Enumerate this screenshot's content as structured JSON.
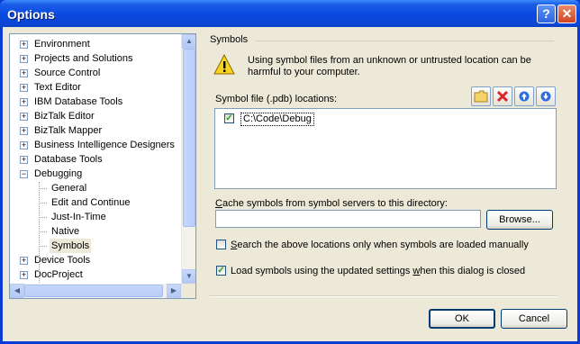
{
  "window": {
    "title": "Options"
  },
  "title_buttons": {
    "help_glyph": "?",
    "close_glyph": "✕"
  },
  "tree": {
    "items": [
      {
        "label": "Environment",
        "expander": "+",
        "indent": 0
      },
      {
        "label": "Projects and Solutions",
        "expander": "+",
        "indent": 0
      },
      {
        "label": "Source Control",
        "expander": "+",
        "indent": 0
      },
      {
        "label": "Text Editor",
        "expander": "+",
        "indent": 0
      },
      {
        "label": "IBM Database Tools",
        "expander": "+",
        "indent": 0
      },
      {
        "label": "BizTalk Editor",
        "expander": "+",
        "indent": 0
      },
      {
        "label": "BizTalk Mapper",
        "expander": "+",
        "indent": 0
      },
      {
        "label": "Business Intelligence Designers",
        "expander": "+",
        "indent": 0
      },
      {
        "label": "Database Tools",
        "expander": "+",
        "indent": 0
      },
      {
        "label": "Debugging",
        "expander": "−",
        "indent": 0
      },
      {
        "label": "General",
        "expander": "",
        "indent": 1
      },
      {
        "label": "Edit and Continue",
        "expander": "",
        "indent": 1
      },
      {
        "label": "Just-In-Time",
        "expander": "",
        "indent": 1
      },
      {
        "label": "Native",
        "expander": "",
        "indent": 1
      },
      {
        "label": "Symbols",
        "expander": "",
        "indent": 1,
        "selected": true
      },
      {
        "label": "Device Tools",
        "expander": "+",
        "indent": 0
      },
      {
        "label": "DocProject",
        "expander": "+",
        "indent": 0
      }
    ]
  },
  "symbols": {
    "group_title": "Symbols",
    "warning_text": "Using symbol files from an unknown or untrusted location can be harmful to your computer.",
    "locations_label": "Symbol file (.pdb) locations:",
    "locations": [
      {
        "path": "C:\\Code\\Debug",
        "checked": true
      }
    ],
    "cache_label_prefix": "C",
    "cache_label_rest": "ache symbols from symbol servers to this directory:",
    "cache_value": "",
    "browse_label": "Browse...",
    "search_manual_prefix": "S",
    "search_manual_rest": "earch the above locations only when symbols are loaded manually",
    "search_manual_checked": false,
    "load_updated_pre": "Load symbols using the updated settings ",
    "load_updated_u": "w",
    "load_updated_post": "hen this dialog is closed",
    "load_updated_checked": true
  },
  "toolbar": {
    "folder_icon": "folder-icon",
    "delete_icon": "delete-icon",
    "up_icon": "move-up-icon",
    "down_icon": "move-down-icon"
  },
  "buttons": {
    "ok": "OK",
    "cancel": "Cancel"
  },
  "colors": {
    "titlebar": "#0a48e0",
    "accent_red": "#d9252b",
    "check_green": "#21a121",
    "dialog_bg": "#ece9d8"
  }
}
